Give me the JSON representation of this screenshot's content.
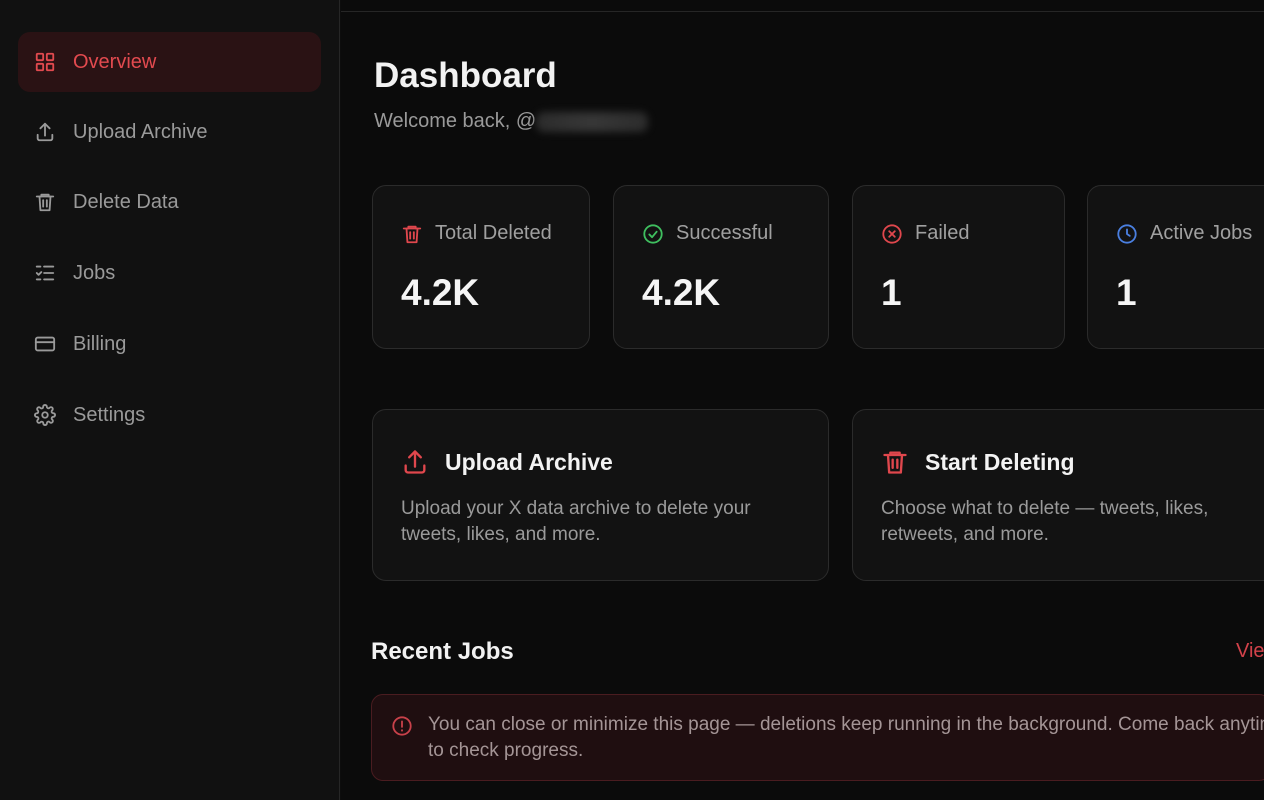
{
  "sidebar": {
    "items": [
      {
        "label": "Overview",
        "icon": "grid-icon",
        "active": true
      },
      {
        "label": "Upload Archive",
        "icon": "upload-icon"
      },
      {
        "label": "Delete Data",
        "icon": "trash-icon"
      },
      {
        "label": "Jobs",
        "icon": "checklist-icon"
      },
      {
        "label": "Billing",
        "icon": "credit-card-icon"
      },
      {
        "label": "Settings",
        "icon": "gear-icon"
      }
    ]
  },
  "header": {
    "title": "Dashboard",
    "welcome_prefix": "Welcome back, @"
  },
  "stats": [
    {
      "label": "Total Deleted",
      "value": "4.2K",
      "icon": "trash-icon",
      "color": "#e0474d"
    },
    {
      "label": "Successful",
      "value": "4.2K",
      "icon": "check-circle-icon",
      "color": "#3fbf5f"
    },
    {
      "label": "Failed",
      "value": "1",
      "icon": "x-circle-icon",
      "color": "#e0474d"
    },
    {
      "label": "Active Jobs",
      "value": "1",
      "icon": "clock-icon",
      "color": "#4a7fe0"
    }
  ],
  "actions": [
    {
      "title": "Upload Archive",
      "description": "Upload your X data archive to delete your tweets, likes, and more.",
      "icon": "upload-icon"
    },
    {
      "title": "Start Deleting",
      "description": "Choose what to delete — tweets, likes, retweets, and more.",
      "icon": "trash-icon"
    }
  ],
  "recent_jobs": {
    "title": "Recent Jobs",
    "view_all": "View all",
    "notice": "You can close or minimize this page — deletions keep running in the background. Come back anytime to check progress."
  },
  "colors": {
    "accent": "#e0474d",
    "background": "#0b0b0b",
    "sidebar": "#111111",
    "card": "#121212"
  }
}
